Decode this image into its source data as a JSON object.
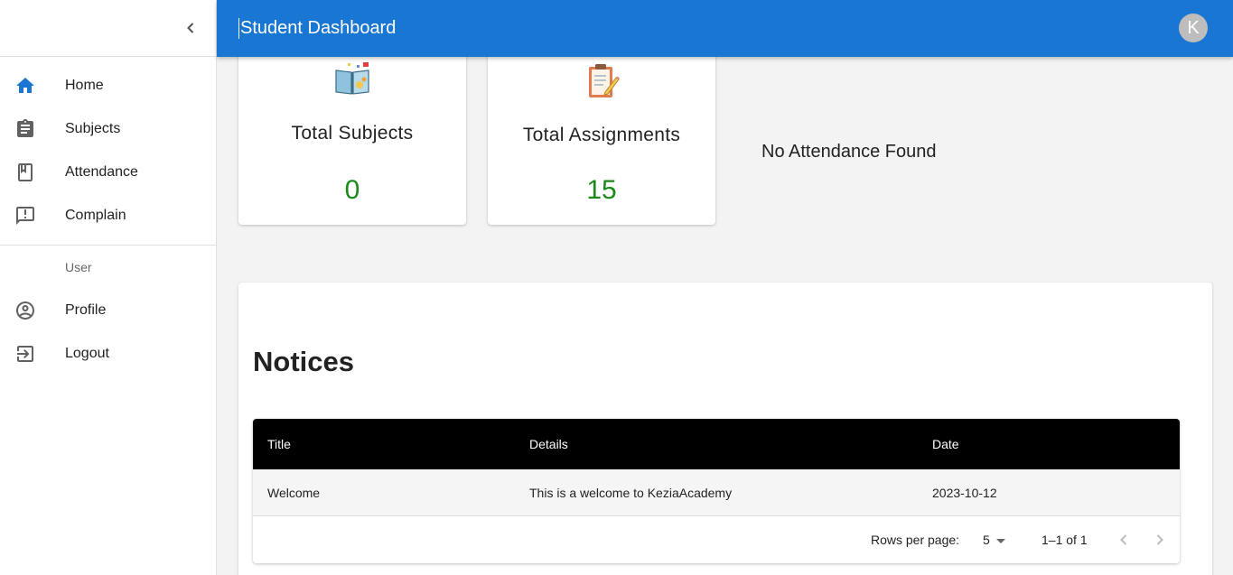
{
  "appbar": {
    "title": "Student Dashboard",
    "avatar_letter": "K"
  },
  "sidebar": {
    "items": [
      {
        "label": "Home",
        "icon": "home-icon"
      },
      {
        "label": "Subjects",
        "icon": "assignment-icon"
      },
      {
        "label": "Attendance",
        "icon": "class-book-icon"
      },
      {
        "label": "Complain",
        "icon": "announcement-icon"
      }
    ],
    "section_header": "User",
    "user_items": [
      {
        "label": "Profile",
        "icon": "account-circle-icon"
      },
      {
        "label": "Logout",
        "icon": "logout-icon"
      }
    ]
  },
  "stats": {
    "subjects": {
      "title": "Total Subjects",
      "value": "0",
      "icon": "open-book-icon"
    },
    "assignments": {
      "title": "Total Assignments",
      "value": "15",
      "icon": "clipboard-icon"
    },
    "attendance_message": "No Attendance Found"
  },
  "notices": {
    "title": "Notices",
    "columns": [
      "Title",
      "Details",
      "Date"
    ],
    "rows": [
      [
        "Welcome",
        "This is a welcome to KeziaAcademy",
        "2023-10-12"
      ]
    ],
    "pagination": {
      "rows_per_page_label": "Rows per page:",
      "rows_per_page": "5",
      "range": "1–1 of 1"
    }
  },
  "colors": {
    "appbar": "#1976d2",
    "stat_value": "#1b8a1b",
    "home_icon": "#1976d2"
  }
}
